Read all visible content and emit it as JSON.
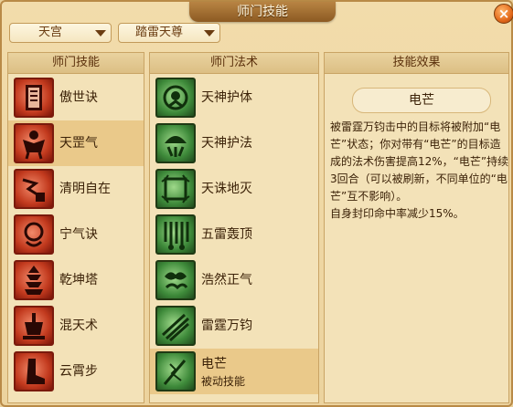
{
  "window": {
    "title": "师门技能",
    "close_icon": "close-icon"
  },
  "filters": {
    "sect": "天宫",
    "master": "踏雷天尊"
  },
  "skills_panel": {
    "header": "师门技能",
    "items": [
      {
        "label": "傲世诀",
        "icon": "scroll-icon"
      },
      {
        "label": "天罡气",
        "icon": "warrior-icon"
      },
      {
        "label": "清明自在",
        "icon": "lightning-icon"
      },
      {
        "label": "宁气诀",
        "icon": "orb-icon"
      },
      {
        "label": "乾坤塔",
        "icon": "pagoda-icon"
      },
      {
        "label": "混天术",
        "icon": "cauldron-icon"
      },
      {
        "label": "云霄步",
        "icon": "boot-icon"
      }
    ],
    "selected_index": 1
  },
  "spells_panel": {
    "header": "师门法术",
    "items": [
      {
        "label": "天神护体",
        "icon": "guardian-icon"
      },
      {
        "label": "天神护法",
        "icon": "shield-icon"
      },
      {
        "label": "天诛地灭",
        "icon": "frame-icon"
      },
      {
        "label": "五雷轰顶",
        "icon": "thunder-icon"
      },
      {
        "label": "浩然正气",
        "icon": "cloud-icon"
      },
      {
        "label": "雷霆万钧",
        "icon": "claw-icon"
      },
      {
        "label": "电芒",
        "sublabel": "被动技能",
        "icon": "lightning-sword-icon"
      }
    ],
    "selected_index": 6
  },
  "effect_panel": {
    "header": "技能效果",
    "skill_name": "电芒",
    "description": "被雷霆万钧击中的目标将被附加“电芒”状态；你对带有“电芒”的目标造成的法术伤害提高12%，“电芒”持续3回合（可以被刷新，不同单位的“电芒”互不影响）。\n自身封印命中率减少15%。"
  },
  "colors": {
    "accent": "#8c5a22",
    "selected_row": "#eac98a",
    "panel_bg": "#f3e2b8"
  }
}
